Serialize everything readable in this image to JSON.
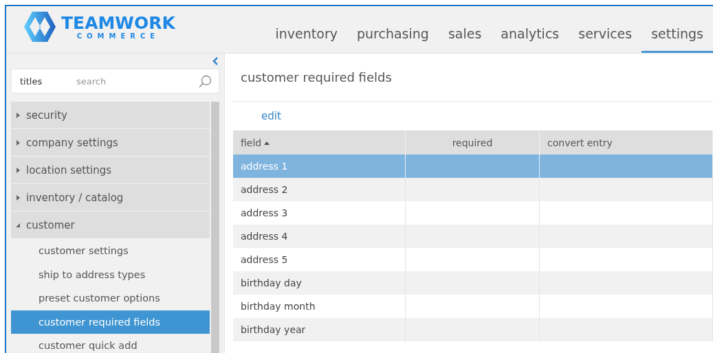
{
  "logo": {
    "name": "TEAMWORK",
    "tagline": "COMMERCE"
  },
  "nav": [
    {
      "label": "inventory",
      "selected": false
    },
    {
      "label": "purchasing",
      "selected": false
    },
    {
      "label": "sales",
      "selected": false
    },
    {
      "label": "analytics",
      "selected": false
    },
    {
      "label": "services",
      "selected": false
    },
    {
      "label": "settings",
      "selected": true
    }
  ],
  "sidebar": {
    "search": {
      "scope": "titles",
      "placeholder": "search"
    },
    "items": [
      {
        "label": "security",
        "expanded": false
      },
      {
        "label": "company settings",
        "expanded": false
      },
      {
        "label": "location settings",
        "expanded": false
      },
      {
        "label": "inventory / catalog",
        "expanded": false
      },
      {
        "label": "customer",
        "expanded": true,
        "children": [
          {
            "label": "customer settings",
            "selected": false
          },
          {
            "label": "ship to address types",
            "selected": false
          },
          {
            "label": "preset customer options",
            "selected": false
          },
          {
            "label": "customer required fields",
            "selected": true
          },
          {
            "label": "customer quick add",
            "selected": false
          }
        ]
      }
    ]
  },
  "page_title": "customer required fields",
  "toolbar": {
    "edit": "edit"
  },
  "table": {
    "columns": [
      {
        "label": "field",
        "sorted": true
      },
      {
        "label": "required",
        "sorted": false
      },
      {
        "label": "convert entry",
        "sorted": false
      }
    ],
    "rows": [
      {
        "field": "address 1",
        "selected": true
      },
      {
        "field": "address 2",
        "selected": false
      },
      {
        "field": "address 3",
        "selected": false
      },
      {
        "field": "address 4",
        "selected": false
      },
      {
        "field": "address 5",
        "selected": false
      },
      {
        "field": "birthday day",
        "selected": false
      },
      {
        "field": "birthday month",
        "selected": false
      },
      {
        "field": "birthday year",
        "selected": false
      }
    ]
  }
}
